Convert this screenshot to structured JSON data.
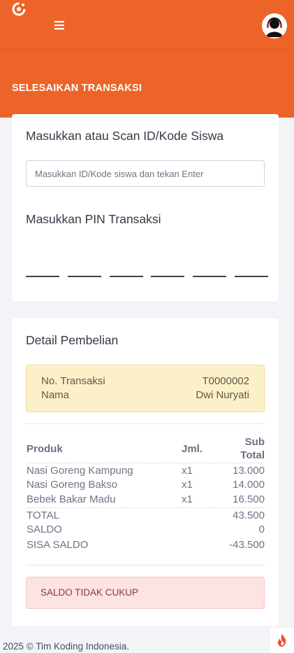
{
  "header": {
    "logo_icon": "swirl-logo-icon",
    "menu_icon": "hamburger-menu-icon",
    "menu_glyph": "≡",
    "avatar_icon": "user-headset-avatar-icon",
    "title": "SELESAIKAN TRANSAKSI",
    "color": "#ed6428"
  },
  "scan": {
    "label": "Masukkan atau Scan ID/Kode Siswa",
    "input_value": "",
    "placeholder": "Masukkan ID/Kode siswa dan tekan Enter"
  },
  "pin": {
    "label": "Masukkan PIN Transaksi",
    "digits": [
      "",
      "",
      "",
      "",
      "",
      ""
    ]
  },
  "detail": {
    "title": "Detail Pembelian",
    "trx_label": "No. Transaksi",
    "trx_value": "T0000002",
    "name_label": "Nama",
    "name_value": "Dwi Nuryati",
    "columns": {
      "product": "Produk",
      "qty": "Jml.",
      "subtotal_line1": "Sub",
      "subtotal_line2": "Total"
    },
    "items": [
      {
        "product": "Nasi Goreng Kampung",
        "qty": "x1",
        "subtotal": "13.000"
      },
      {
        "product": "Nasi Goreng Bakso",
        "qty": "x1",
        "subtotal": "14.000"
      },
      {
        "product": "Bebek Bakar Madu",
        "qty": "x1",
        "subtotal": "16.500"
      }
    ],
    "summary": [
      {
        "label": "TOTAL",
        "value": "43.500"
      },
      {
        "label": "SALDO",
        "value": "0"
      },
      {
        "label": "SISA SALDO",
        "value": "-43.500"
      }
    ],
    "alert": "SALDO TIDAK CUKUP",
    "alert_color": "#fde3e2"
  },
  "footer": {
    "text": "2025 © Tim Koding Indonesia.",
    "fab_icon": "flame-icon"
  }
}
